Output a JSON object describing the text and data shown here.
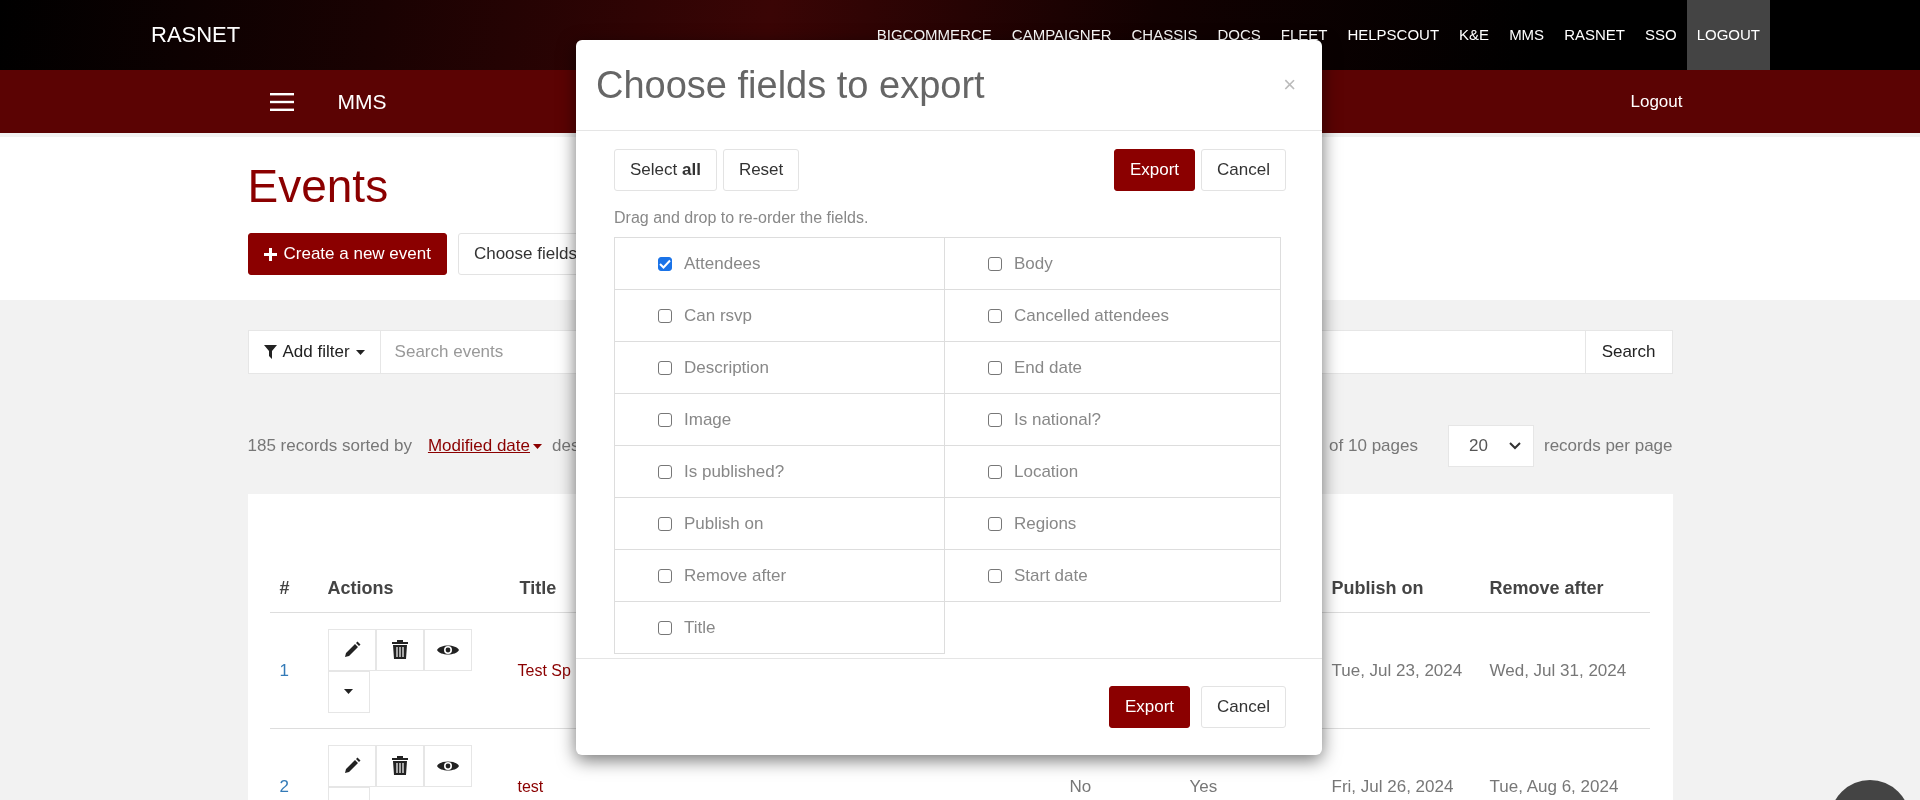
{
  "topbar": {
    "brand": "RASNET",
    "links": [
      {
        "label": "BIGCOMMERCE",
        "selected": false
      },
      {
        "label": "CAMPAIGNER",
        "selected": false
      },
      {
        "label": "CHASSIS",
        "selected": false
      },
      {
        "label": "DOCS",
        "selected": false
      },
      {
        "label": "FLEET",
        "selected": false
      },
      {
        "label": "HELPSCOUT",
        "selected": false
      },
      {
        "label": "K&E",
        "selected": false
      },
      {
        "label": "MMS",
        "selected": false
      },
      {
        "label": "RASNET",
        "selected": false
      },
      {
        "label": "SSO",
        "selected": false
      },
      {
        "label": "LOGOUT",
        "selected": true
      }
    ]
  },
  "appbar": {
    "title": "MMS",
    "logout": "Logout"
  },
  "page": {
    "title": "Events",
    "create_button": "Create a new event",
    "choose_fields_button": "Choose fields"
  },
  "filter": {
    "add_filter": "Add filter",
    "search_placeholder": "Search events",
    "search_button": "Search"
  },
  "summary": {
    "count_text": "185 records sorted by",
    "sort_field": "Modified date",
    "direction": "des",
    "pages_text": "of 10 pages",
    "per_page": "20",
    "per_page_label": "records per page"
  },
  "table": {
    "columns": [
      "#",
      "Actions",
      "Title",
      "",
      "",
      "Publish on",
      "Remove after"
    ],
    "rows": [
      {
        "number": "1",
        "title": "Test Sp",
        "column_4": "",
        "column_5": "",
        "publish_on": "Tue, Jul 23, 2024",
        "remove_after": "Wed, Jul 31, 2024"
      },
      {
        "number": "2",
        "title": "test",
        "column_4": "No",
        "column_5": "Yes",
        "publish_on": "Fri, Jul 26, 2024",
        "remove_after": "Tue, Aug 6, 2024"
      }
    ]
  },
  "modal": {
    "title": "Choose fields to export",
    "close": "×",
    "select_all": "Select **all**",
    "reset": "Reset",
    "export": "Export",
    "cancel": "Cancel",
    "hint": "Drag and drop to re-order the fields.",
    "fields": [
      {
        "label": "Attendees",
        "checked": true
      },
      {
        "label": "Body",
        "checked": false
      },
      {
        "label": "Can rsvp",
        "checked": false
      },
      {
        "label": "Cancelled attendees",
        "checked": false
      },
      {
        "label": "Description",
        "checked": false
      },
      {
        "label": "End date",
        "checked": false
      },
      {
        "label": "Image",
        "checked": false
      },
      {
        "label": "Is national?",
        "checked": false
      },
      {
        "label": "Is published?",
        "checked": false
      },
      {
        "label": "Location",
        "checked": false
      },
      {
        "label": "Publish on",
        "checked": false
      },
      {
        "label": "Regions",
        "checked": false
      },
      {
        "label": "Remove after",
        "checked": false
      },
      {
        "label": "Start date",
        "checked": false
      },
      {
        "label": "Title",
        "checked": false
      }
    ],
    "footer_export": "Export",
    "footer_cancel": "Cancel"
  }
}
